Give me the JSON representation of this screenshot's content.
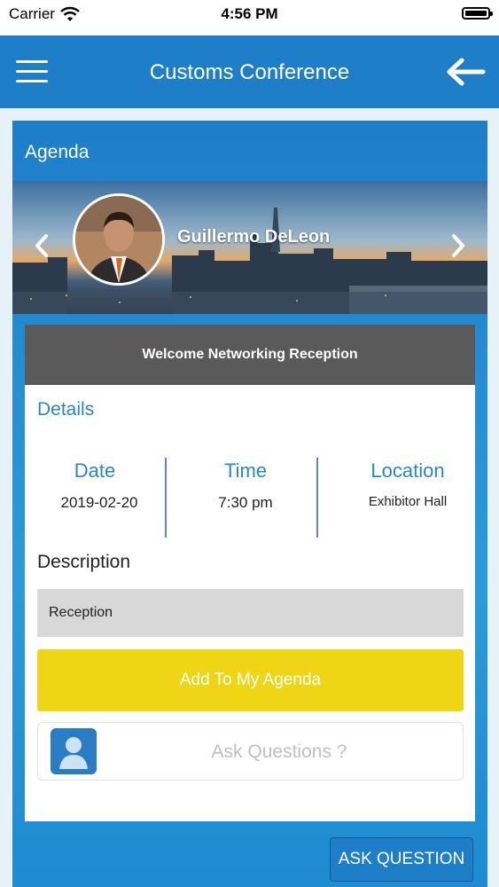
{
  "status_bar": {
    "carrier": "Carrier",
    "time": "4:56 PM"
  },
  "nav": {
    "title": "Customs Conference",
    "menu_icon": "hamburger-icon",
    "back_icon": "arrow-left-icon"
  },
  "card": {
    "title": "Agenda"
  },
  "banner": {
    "speaker_name": "Guillermo DeLeon",
    "prev_icon": "chevron-left-icon",
    "next_icon": "chevron-right-icon"
  },
  "session": {
    "title": "Welcome Networking Reception",
    "details_label": "Details",
    "date_label": "Date",
    "date_value": "2019-02-20",
    "time_label": "Time",
    "time_value": "7:30 pm",
    "location_label": "Location",
    "location_value": "Exhibitor Hall",
    "description_label": "Description",
    "description_value": "Reception",
    "add_agenda_label": "Add To My Agenda",
    "ask_placeholder": "Ask Questions ?"
  },
  "footer": {
    "ask_question_label": "ASK QUESTION"
  },
  "colors": {
    "primary": "#1f7ec8",
    "accent_yellow": "#eed617",
    "header_gray": "#5a5a5a",
    "label_blue": "#2a86c6"
  }
}
